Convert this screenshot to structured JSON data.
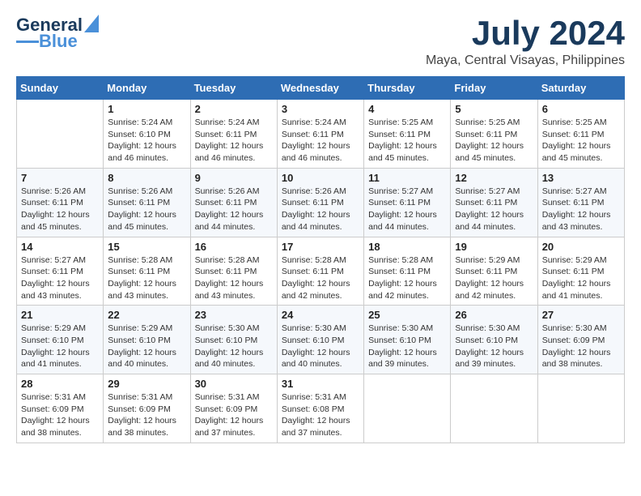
{
  "logo": {
    "line1": "General",
    "line2": "Blue"
  },
  "header": {
    "month": "July 2024",
    "location": "Maya, Central Visayas, Philippines"
  },
  "weekdays": [
    "Sunday",
    "Monday",
    "Tuesday",
    "Wednesday",
    "Thursday",
    "Friday",
    "Saturday"
  ],
  "weeks": [
    [
      {
        "day": "",
        "info": ""
      },
      {
        "day": "1",
        "info": "Sunrise: 5:24 AM\nSunset: 6:10 PM\nDaylight: 12 hours\nand 46 minutes."
      },
      {
        "day": "2",
        "info": "Sunrise: 5:24 AM\nSunset: 6:11 PM\nDaylight: 12 hours\nand 46 minutes."
      },
      {
        "day": "3",
        "info": "Sunrise: 5:24 AM\nSunset: 6:11 PM\nDaylight: 12 hours\nand 46 minutes."
      },
      {
        "day": "4",
        "info": "Sunrise: 5:25 AM\nSunset: 6:11 PM\nDaylight: 12 hours\nand 45 minutes."
      },
      {
        "day": "5",
        "info": "Sunrise: 5:25 AM\nSunset: 6:11 PM\nDaylight: 12 hours\nand 45 minutes."
      },
      {
        "day": "6",
        "info": "Sunrise: 5:25 AM\nSunset: 6:11 PM\nDaylight: 12 hours\nand 45 minutes."
      }
    ],
    [
      {
        "day": "7",
        "info": "Sunrise: 5:26 AM\nSunset: 6:11 PM\nDaylight: 12 hours\nand 45 minutes."
      },
      {
        "day": "8",
        "info": "Sunrise: 5:26 AM\nSunset: 6:11 PM\nDaylight: 12 hours\nand 45 minutes."
      },
      {
        "day": "9",
        "info": "Sunrise: 5:26 AM\nSunset: 6:11 PM\nDaylight: 12 hours\nand 44 minutes."
      },
      {
        "day": "10",
        "info": "Sunrise: 5:26 AM\nSunset: 6:11 PM\nDaylight: 12 hours\nand 44 minutes."
      },
      {
        "day": "11",
        "info": "Sunrise: 5:27 AM\nSunset: 6:11 PM\nDaylight: 12 hours\nand 44 minutes."
      },
      {
        "day": "12",
        "info": "Sunrise: 5:27 AM\nSunset: 6:11 PM\nDaylight: 12 hours\nand 44 minutes."
      },
      {
        "day": "13",
        "info": "Sunrise: 5:27 AM\nSunset: 6:11 PM\nDaylight: 12 hours\nand 43 minutes."
      }
    ],
    [
      {
        "day": "14",
        "info": "Sunrise: 5:27 AM\nSunset: 6:11 PM\nDaylight: 12 hours\nand 43 minutes."
      },
      {
        "day": "15",
        "info": "Sunrise: 5:28 AM\nSunset: 6:11 PM\nDaylight: 12 hours\nand 43 minutes."
      },
      {
        "day": "16",
        "info": "Sunrise: 5:28 AM\nSunset: 6:11 PM\nDaylight: 12 hours\nand 43 minutes."
      },
      {
        "day": "17",
        "info": "Sunrise: 5:28 AM\nSunset: 6:11 PM\nDaylight: 12 hours\nand 42 minutes."
      },
      {
        "day": "18",
        "info": "Sunrise: 5:28 AM\nSunset: 6:11 PM\nDaylight: 12 hours\nand 42 minutes."
      },
      {
        "day": "19",
        "info": "Sunrise: 5:29 AM\nSunset: 6:11 PM\nDaylight: 12 hours\nand 42 minutes."
      },
      {
        "day": "20",
        "info": "Sunrise: 5:29 AM\nSunset: 6:11 PM\nDaylight: 12 hours\nand 41 minutes."
      }
    ],
    [
      {
        "day": "21",
        "info": "Sunrise: 5:29 AM\nSunset: 6:10 PM\nDaylight: 12 hours\nand 41 minutes."
      },
      {
        "day": "22",
        "info": "Sunrise: 5:29 AM\nSunset: 6:10 PM\nDaylight: 12 hours\nand 40 minutes."
      },
      {
        "day": "23",
        "info": "Sunrise: 5:30 AM\nSunset: 6:10 PM\nDaylight: 12 hours\nand 40 minutes."
      },
      {
        "day": "24",
        "info": "Sunrise: 5:30 AM\nSunset: 6:10 PM\nDaylight: 12 hours\nand 40 minutes."
      },
      {
        "day": "25",
        "info": "Sunrise: 5:30 AM\nSunset: 6:10 PM\nDaylight: 12 hours\nand 39 minutes."
      },
      {
        "day": "26",
        "info": "Sunrise: 5:30 AM\nSunset: 6:10 PM\nDaylight: 12 hours\nand 39 minutes."
      },
      {
        "day": "27",
        "info": "Sunrise: 5:30 AM\nSunset: 6:09 PM\nDaylight: 12 hours\nand 38 minutes."
      }
    ],
    [
      {
        "day": "28",
        "info": "Sunrise: 5:31 AM\nSunset: 6:09 PM\nDaylight: 12 hours\nand 38 minutes."
      },
      {
        "day": "29",
        "info": "Sunrise: 5:31 AM\nSunset: 6:09 PM\nDaylight: 12 hours\nand 38 minutes."
      },
      {
        "day": "30",
        "info": "Sunrise: 5:31 AM\nSunset: 6:09 PM\nDaylight: 12 hours\nand 37 minutes."
      },
      {
        "day": "31",
        "info": "Sunrise: 5:31 AM\nSunset: 6:08 PM\nDaylight: 12 hours\nand 37 minutes."
      },
      {
        "day": "",
        "info": ""
      },
      {
        "day": "",
        "info": ""
      },
      {
        "day": "",
        "info": ""
      }
    ]
  ]
}
